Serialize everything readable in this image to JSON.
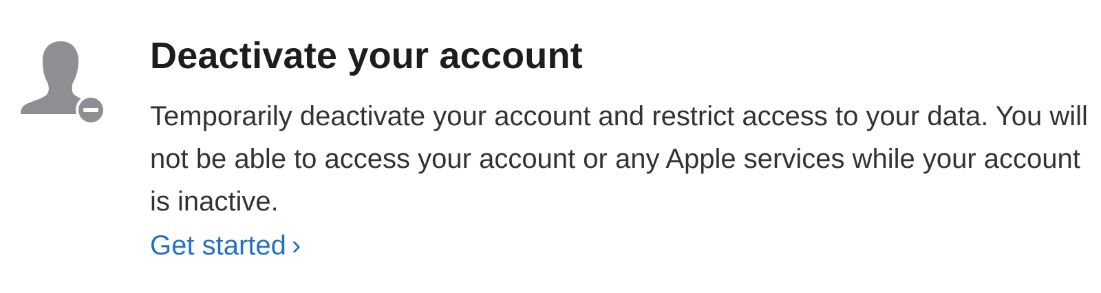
{
  "section": {
    "icon": "user-remove-icon",
    "title": "Deactivate your account",
    "description": "Temporarily deactivate your account and restrict access to your data. You will not be able to access your account or any Apple services while your account is inactive.",
    "link_label": "Get started",
    "link_chevron": "›"
  },
  "colors": {
    "icon_gray": "#8e8e93",
    "link_blue": "#2371c5",
    "title_text": "#1d1d1f",
    "body_text": "#333336"
  }
}
